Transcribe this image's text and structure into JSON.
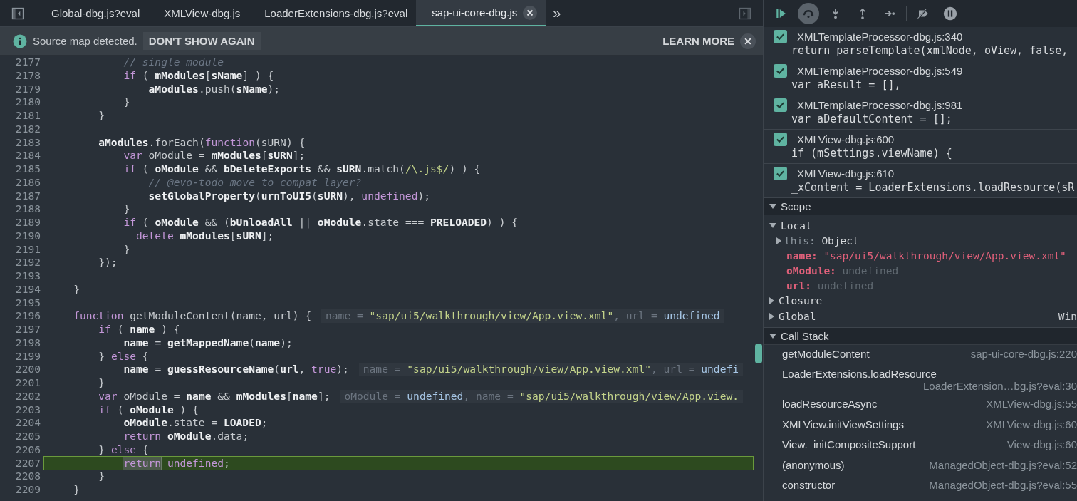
{
  "tabs": [
    {
      "label": "Global-dbg.js?eval",
      "selected": false,
      "closable": false
    },
    {
      "label": "XMLView-dbg.js",
      "selected": false,
      "closable": false
    },
    {
      "label": "LoaderExtensions-dbg.js?eval",
      "selected": false,
      "closable": false
    },
    {
      "label": "sap-ui-core-dbg.js",
      "selected": true,
      "closable": true
    }
  ],
  "more_tabs": "»",
  "infobar": {
    "message": "Source map detected.",
    "dismiss": "DON'T SHOW AGAIN",
    "link": "LEARN MORE"
  },
  "editor": {
    "lines": [
      {
        "number": "2177",
        "current": false,
        "tokens": [
          {
            "kind": "c",
            "text": "            // single module"
          }
        ]
      },
      {
        "number": "2178",
        "current": false,
        "tokens": [
          {
            "kind": "k",
            "text": "            if"
          },
          {
            "kind": "p",
            "text": " ( "
          },
          {
            "kind": "v",
            "text": "mModules"
          },
          {
            "kind": "p",
            "text": "["
          },
          {
            "kind": "v",
            "text": "sName"
          },
          {
            "kind": "p",
            "text": "] ) {"
          }
        ]
      },
      {
        "number": "2179",
        "current": false,
        "tokens": [
          {
            "kind": "v",
            "text": "                aModules"
          },
          {
            "kind": "p",
            "text": ".push("
          },
          {
            "kind": "v",
            "text": "sName"
          },
          {
            "kind": "p",
            "text": ");"
          }
        ]
      },
      {
        "number": "2180",
        "current": false,
        "tokens": [
          {
            "kind": "p",
            "text": "            }"
          }
        ]
      },
      {
        "number": "2181",
        "current": false,
        "tokens": [
          {
            "kind": "p",
            "text": "        }"
          }
        ]
      },
      {
        "number": "2182",
        "current": false
      },
      {
        "number": "2183",
        "current": false,
        "tokens": [
          {
            "kind": "v",
            "text": "        aModules"
          },
          {
            "kind": "p",
            "text": ".forEach("
          },
          {
            "kind": "k",
            "text": "function"
          },
          {
            "kind": "p",
            "text": "(sURN) {"
          }
        ]
      },
      {
        "number": "2184",
        "current": false,
        "tokens": [
          {
            "kind": "k",
            "text": "            var"
          },
          {
            "kind": "p",
            "text": " oModule = "
          },
          {
            "kind": "v",
            "text": "mModules"
          },
          {
            "kind": "p",
            "text": "["
          },
          {
            "kind": "v",
            "text": "sURN"
          },
          {
            "kind": "p",
            "text": "];"
          }
        ]
      },
      {
        "number": "2185",
        "current": false,
        "tokens": [
          {
            "kind": "k",
            "text": "            if"
          },
          {
            "kind": "p",
            "text": " ( "
          },
          {
            "kind": "v",
            "text": "oModule"
          },
          {
            "kind": "p",
            "text": " && "
          },
          {
            "kind": "v",
            "text": "bDeleteExports"
          },
          {
            "kind": "p",
            "text": " && "
          },
          {
            "kind": "v",
            "text": "sURN"
          },
          {
            "kind": "p",
            "text": ".match("
          },
          {
            "kind": "s",
            "text": "/\\.js$/"
          },
          {
            "kind": "p",
            "text": ") ) {"
          }
        ]
      },
      {
        "number": "2186",
        "current": false,
        "tokens": [
          {
            "kind": "c",
            "text": "                // @evo-todo move to compat layer?"
          }
        ]
      },
      {
        "number": "2187",
        "current": false,
        "tokens": [
          {
            "kind": "v",
            "text": "                setGlobalProperty"
          },
          {
            "kind": "p",
            "text": "("
          },
          {
            "kind": "v",
            "text": "urnToUI5"
          },
          {
            "kind": "p",
            "text": "("
          },
          {
            "kind": "v",
            "text": "sURN"
          },
          {
            "kind": "p",
            "text": "), "
          },
          {
            "kind": "k",
            "text": "undefined"
          },
          {
            "kind": "p",
            "text": ");"
          }
        ]
      },
      {
        "number": "2188",
        "current": false,
        "tokens": [
          {
            "kind": "p",
            "text": "            }"
          }
        ]
      },
      {
        "number": "2189",
        "current": false,
        "tokens": [
          {
            "kind": "k",
            "text": "            if"
          },
          {
            "kind": "p",
            "text": " ( "
          },
          {
            "kind": "v",
            "text": "oModule"
          },
          {
            "kind": "p",
            "text": " && ("
          },
          {
            "kind": "v",
            "text": "bUnloadAll"
          },
          {
            "kind": "p",
            "text": " || "
          },
          {
            "kind": "v",
            "text": "oModule"
          },
          {
            "kind": "p",
            "text": ".state === "
          },
          {
            "kind": "v",
            "text": "PRELOADED"
          },
          {
            "kind": "p",
            "text": ") ) {"
          }
        ]
      },
      {
        "number": "2190",
        "current": false,
        "tokens": [
          {
            "kind": "k",
            "text": "              delete "
          },
          {
            "kind": "v",
            "text": "mModules"
          },
          {
            "kind": "p",
            "text": "["
          },
          {
            "kind": "v",
            "text": "sURN"
          },
          {
            "kind": "p",
            "text": "];"
          }
        ]
      },
      {
        "number": "2191",
        "current": false,
        "tokens": [
          {
            "kind": "p",
            "text": "            }"
          }
        ]
      },
      {
        "number": "2192",
        "current": false,
        "tokens": [
          {
            "kind": "p",
            "text": "        });"
          }
        ]
      },
      {
        "number": "2193",
        "current": false
      },
      {
        "number": "2194",
        "current": false,
        "tokens": [
          {
            "kind": "p",
            "text": "    }"
          }
        ]
      },
      {
        "number": "2195",
        "current": false
      },
      {
        "number": "2196",
        "current": false,
        "tokens": [
          {
            "kind": "k",
            "text": "    function"
          },
          {
            "kind": "p",
            "text": " getModuleContent(name, url) {"
          }
        ],
        "inline_value": [
          {
            "kind": "h",
            "text": "name = "
          },
          {
            "kind": "s",
            "text": "\"sap/ui5/walkthrough/view/App.view.xml\""
          },
          {
            "kind": "h",
            "text": ", url = "
          },
          {
            "kind": "u",
            "text": "undefined"
          }
        ]
      },
      {
        "number": "2197",
        "current": false,
        "tokens": [
          {
            "kind": "k",
            "text": "        if"
          },
          {
            "kind": "p",
            "text": " ( "
          },
          {
            "kind": "v",
            "text": "name"
          },
          {
            "kind": "p",
            "text": " ) {"
          }
        ]
      },
      {
        "number": "2198",
        "current": false,
        "tokens": [
          {
            "kind": "v",
            "text": "            name"
          },
          {
            "kind": "p",
            "text": " = "
          },
          {
            "kind": "v",
            "text": "getMappedName"
          },
          {
            "kind": "p",
            "text": "("
          },
          {
            "kind": "v",
            "text": "name"
          },
          {
            "kind": "p",
            "text": ");"
          }
        ]
      },
      {
        "number": "2199",
        "current": false,
        "tokens": [
          {
            "kind": "p",
            "text": "        } "
          },
          {
            "kind": "k",
            "text": "else"
          },
          {
            "kind": "p",
            "text": " {"
          }
        ]
      },
      {
        "number": "2200",
        "current": false,
        "tokens": [
          {
            "kind": "v",
            "text": "            name"
          },
          {
            "kind": "p",
            "text": " = "
          },
          {
            "kind": "v",
            "text": "guessResourceName"
          },
          {
            "kind": "p",
            "text": "("
          },
          {
            "kind": "v",
            "text": "url"
          },
          {
            "kind": "p",
            "text": ", "
          },
          {
            "kind": "k",
            "text": "true"
          },
          {
            "kind": "p",
            "text": ");"
          }
        ],
        "inline_value": [
          {
            "kind": "h",
            "text": "name = "
          },
          {
            "kind": "s",
            "text": "\"sap/ui5/walkthrough/view/App.view.xml\""
          },
          {
            "kind": "h",
            "text": ", url = "
          },
          {
            "kind": "u",
            "text": "undefi"
          }
        ]
      },
      {
        "number": "2201",
        "current": false,
        "tokens": [
          {
            "kind": "p",
            "text": "        }"
          }
        ]
      },
      {
        "number": "2202",
        "current": false,
        "tokens": [
          {
            "kind": "k",
            "text": "        var"
          },
          {
            "kind": "p",
            "text": " oModule = "
          },
          {
            "kind": "v",
            "text": "name"
          },
          {
            "kind": "p",
            "text": " && "
          },
          {
            "kind": "v",
            "text": "mModules"
          },
          {
            "kind": "p",
            "text": "["
          },
          {
            "kind": "v",
            "text": "name"
          },
          {
            "kind": "p",
            "text": "];"
          }
        ],
        "inline_value": [
          {
            "kind": "h",
            "text": "oModule = "
          },
          {
            "kind": "u",
            "text": "undefined"
          },
          {
            "kind": "h",
            "text": ", name = "
          },
          {
            "kind": "s",
            "text": "\"sap/ui5/walkthrough/view/App.view."
          }
        ]
      },
      {
        "number": "2203",
        "current": false,
        "tokens": [
          {
            "kind": "k",
            "text": "        if"
          },
          {
            "kind": "p",
            "text": " ( "
          },
          {
            "kind": "v",
            "text": "oModule"
          },
          {
            "kind": "p",
            "text": " ) {"
          }
        ]
      },
      {
        "number": "2204",
        "current": false,
        "tokens": [
          {
            "kind": "v",
            "text": "            oModule"
          },
          {
            "kind": "p",
            "text": ".state = "
          },
          {
            "kind": "v",
            "text": "LOADED"
          },
          {
            "kind": "p",
            "text": ";"
          }
        ]
      },
      {
        "number": "2205",
        "current": false,
        "tokens": [
          {
            "kind": "k",
            "text": "            return "
          },
          {
            "kind": "v",
            "text": "oModule"
          },
          {
            "kind": "p",
            "text": ".data;"
          }
        ]
      },
      {
        "number": "2206",
        "current": false,
        "tokens": [
          {
            "kind": "p",
            "text": "        } "
          },
          {
            "kind": "k",
            "text": "else"
          },
          {
            "kind": "p",
            "text": " {"
          }
        ]
      },
      {
        "number": "2207",
        "current": true,
        "tokens": [
          {
            "kind": "x",
            "text": "            return"
          },
          {
            "kind": "k",
            "text": " undefined"
          },
          {
            "kind": "p",
            "text": ";"
          }
        ]
      },
      {
        "number": "2208",
        "current": false,
        "tokens": [
          {
            "kind": "p",
            "text": "        }"
          }
        ]
      },
      {
        "number": "2209",
        "current": false,
        "tokens": [
          {
            "kind": "p",
            "text": "    }"
          }
        ]
      }
    ]
  },
  "debug_toolbar": [
    {
      "kind": "resume",
      "highlighted": false
    },
    {
      "kind": "step-over",
      "highlighted": true
    },
    {
      "kind": "step-into",
      "highlighted": false
    },
    {
      "kind": "step-out",
      "highlighted": false
    },
    {
      "kind": "step",
      "highlighted": false
    },
    {
      "kind": "divider"
    },
    {
      "kind": "deactivate",
      "highlighted": false
    },
    {
      "kind": "pause-exceptions",
      "highlighted": false
    }
  ],
  "breakpoints": [
    {
      "file": "XMLTemplateProcessor-dbg.js:340",
      "code": "return parseTemplate(xmlNode, oView, false,",
      "checked": true
    },
    {
      "file": "XMLTemplateProcessor-dbg.js:549",
      "code": "var aResult = [],",
      "checked": true
    },
    {
      "file": "XMLTemplateProcessor-dbg.js:981",
      "code": "var aDefaultContent = [];",
      "checked": true
    },
    {
      "file": "XMLView-dbg.js:600",
      "code": "if (mSettings.viewName) {",
      "checked": true
    },
    {
      "file": "XMLView-dbg.js:610",
      "code": "_xContent = LoaderExtensions.loadResource(sR",
      "checked": true
    }
  ],
  "scope": {
    "title": "Scope",
    "expanded": true,
    "groups": [
      {
        "label": "Local",
        "expanded": true,
        "children": [
          {
            "key": "this:",
            "value": "Object",
            "kind": "object",
            "expanded": false
          },
          {
            "key": "name:",
            "value": "\"sap/ui5/walkthrough/view/App.view.xml\"",
            "kind": "string"
          },
          {
            "key": "oModule:",
            "value": "undefined",
            "kind": "undefined"
          },
          {
            "key": "url:",
            "value": "undefined",
            "kind": "undefined"
          }
        ]
      },
      {
        "label": "Closure",
        "expanded": false
      },
      {
        "label": "Global",
        "expanded": false,
        "value": "Win"
      }
    ]
  },
  "call_stack": {
    "title": "Call Stack",
    "expanded": true,
    "frames": [
      {
        "function": "getModuleContent",
        "location": "sap-ui-core-dbg.js:220"
      },
      {
        "function": "LoaderExtensions.loadResource",
        "location": "LoaderExtension…bg.js?eval:30"
      },
      {
        "function": "loadResourceAsync",
        "location": "XMLView-dbg.js:55"
      },
      {
        "function": "XMLView.initViewSettings",
        "location": "XMLView-dbg.js:60"
      },
      {
        "function": "View._initCompositeSupport",
        "location": "View-dbg.js:60"
      },
      {
        "function": "(anonymous)",
        "location": "ManagedObject-dbg.js?eval:52"
      },
      {
        "function": "constructor",
        "location": "ManagedObject-dbg.js?eval:55"
      }
    ]
  }
}
